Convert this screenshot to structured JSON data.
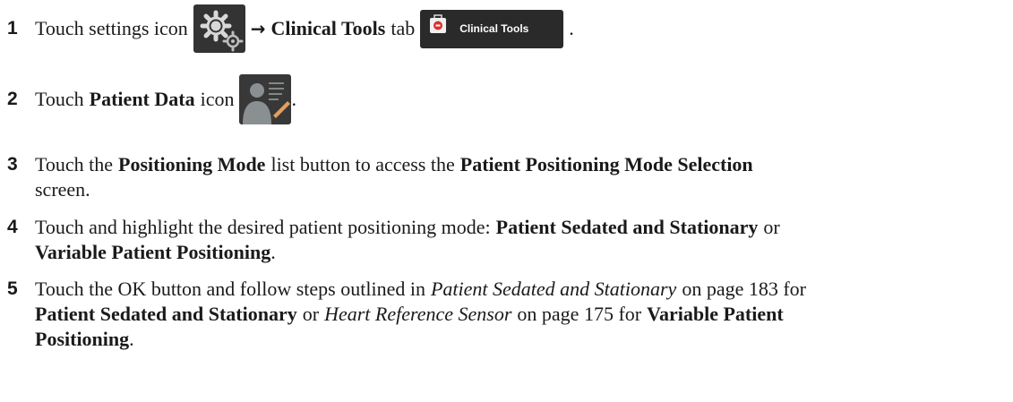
{
  "steps": [
    {
      "number": "1",
      "touch_settings_text": "Touch settings icon",
      "arrow": "→",
      "clinical_tools_bold": "Clinical Tools",
      "tab_text": "tab",
      "tab_button_label": "Clinical Tools",
      "end_punct": "."
    },
    {
      "number": "2",
      "pre_text": "Touch",
      "patient_data_bold": "Patient Data",
      "post_text": "icon",
      "end_punct": "."
    },
    {
      "number": "3",
      "pre_text": "Touch the",
      "positioning_mode_bold": "Positioning Mode",
      "mid_text": "list button to access the",
      "selection_bold": "Patient Positioning Mode Selection",
      "line2_text": "screen."
    },
    {
      "number": "4",
      "pre_text": "Touch and highlight the desired patient positioning mode:",
      "option1_bold": "Patient Sedated and Stationary",
      "or_text": "or",
      "option2_bold": "Variable Patient Positioning",
      "end_punct": "."
    },
    {
      "number": "5",
      "pre_text": "Touch the OK button and follow steps outlined in",
      "ref1_italic": "Patient Sedated and Stationary",
      "page_text_1": "on page 183 for",
      "bold1": "Patient Sedated and Stationary",
      "or_text": "or",
      "ref2_italic": "Heart Reference Sensor",
      "page_text_2": "on page 175 for",
      "bold2": "Variable Patient",
      "bold3": "Positioning",
      "end_punct": "."
    }
  ],
  "icons": {
    "settings": "gear-icon",
    "clinical_tab": "medical-kit-icon",
    "patient_data": "patient-silhouette-icon"
  },
  "colors": {
    "icon_bg": "#2b2b2b",
    "kit_red": "#d9302c",
    "text": "#1a1a1a"
  }
}
